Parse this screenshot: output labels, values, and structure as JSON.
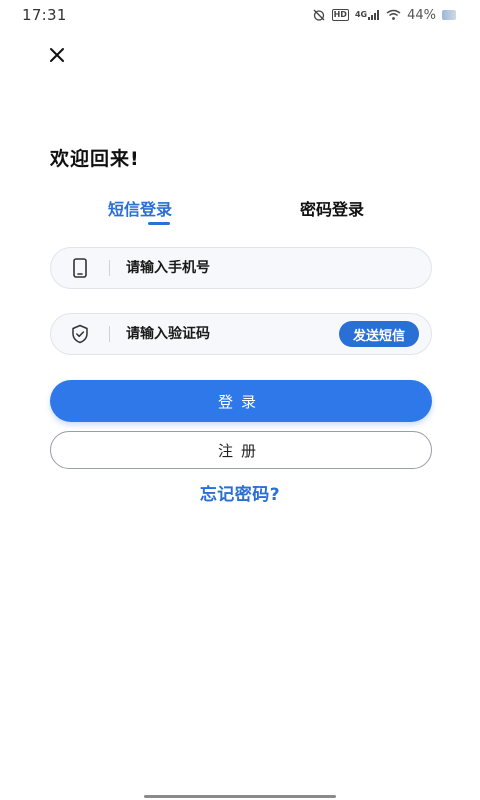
{
  "status_bar": {
    "time": "17:31",
    "battery": "44%",
    "network_label": "4G",
    "hd_label": "HD",
    "icons": [
      "alarm-off-icon",
      "hd-icon",
      "signal-4g-icon",
      "wifi-icon",
      "battery-icon"
    ]
  },
  "header": {
    "close_icon": "close-icon",
    "welcome": "欢迎回来!"
  },
  "tabs": [
    {
      "label": "短信登录",
      "active": true
    },
    {
      "label": "密码登录",
      "active": false
    }
  ],
  "form": {
    "phone": {
      "placeholder": "请输入手机号",
      "value": "",
      "icon": "phone-icon"
    },
    "code": {
      "placeholder": "请输入验证码",
      "value": "",
      "icon": "shield-check-icon",
      "send_label": "发送短信"
    }
  },
  "actions": {
    "login_label": "登录",
    "register_label": "注册",
    "forgot_label": "忘记密码?"
  },
  "colors": {
    "accent": "#2a6fd6",
    "login_button": "#2f78ea",
    "field_bg": "#f7f8fb"
  }
}
